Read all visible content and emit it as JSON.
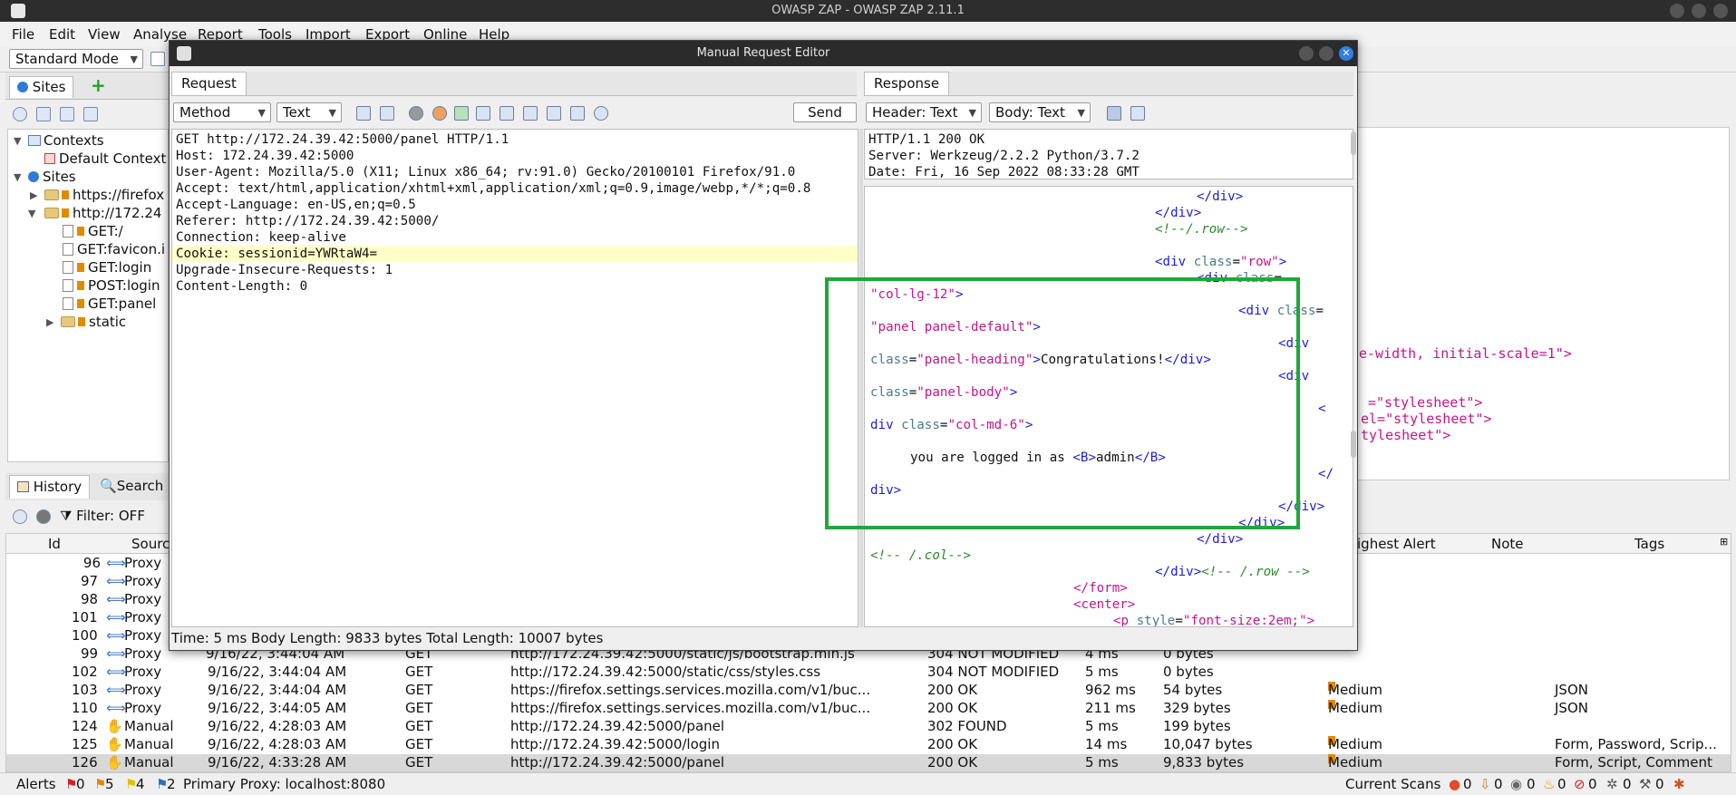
{
  "os": {
    "title": "OWASP ZAP - OWASP ZAP 2.11.1"
  },
  "menu": [
    "File",
    "Edit",
    "View",
    "Analyse",
    "Report",
    "Tools",
    "Import",
    "Export",
    "Online",
    "Help"
  ],
  "toolbar": {
    "mode": "Standard Mode"
  },
  "sites": {
    "tab": "Sites",
    "tree": {
      "contexts": "Contexts",
      "default_context": "Default Context",
      "sites": "Sites",
      "site1": "https://firefox",
      "site2": "http://172.24",
      "children": [
        "GET:/",
        "GET:favicon.i",
        "GET:login",
        "POST:login",
        "GET:panel"
      ],
      "static": "static"
    }
  },
  "bg_right": {
    "line1": "e-width, initial-scale=1\">",
    "line2": "=\"stylesheet\">",
    "line3": "el=\"stylesheet\">",
    "line4": "tylesheet\">"
  },
  "history": {
    "tab": "History",
    "search_tab": "Search",
    "filter": "Filter: OFF",
    "columns": {
      "id": "Id",
      "source": "Source",
      "alert": "ighest Alert",
      "note": "Note",
      "tags": "Tags"
    },
    "rows": [
      {
        "id": "96",
        "src": "Proxy",
        "time": "",
        "method": "",
        "url": "",
        "code": "",
        "rtt": "",
        "size": "",
        "alert": "",
        "tags": ""
      },
      {
        "id": "97",
        "src": "Proxy",
        "time": "",
        "method": "",
        "url": "",
        "code": "",
        "rtt": "",
        "size": "",
        "alert": "",
        "tags": ""
      },
      {
        "id": "98",
        "src": "Proxy",
        "time": "",
        "method": "",
        "url": "",
        "code": "",
        "rtt": "",
        "size": "",
        "alert": "",
        "tags": ""
      },
      {
        "id": "101",
        "src": "Proxy",
        "time": "",
        "method": "",
        "url": "",
        "code": "",
        "rtt": "",
        "size": "",
        "alert": "",
        "tags": ""
      },
      {
        "id": "100",
        "src": "Proxy",
        "time": "",
        "method": "",
        "url": "",
        "code": "",
        "rtt": "",
        "size": "",
        "alert": "",
        "tags": ""
      },
      {
        "id": "99",
        "src": "Proxy",
        "time": "",
        "method": "",
        "url": "",
        "code": "",
        "rtt": "",
        "size": "",
        "alert": "",
        "tags": ""
      },
      {
        "id": "102",
        "src": "Proxy",
        "time": "9/16/22, 3:44:04 AM",
        "method": "GET",
        "url": "http://172.24.39.42:5000/static/css/styles.css",
        "code": "304 NOT MODIFIED",
        "rtt": "5 ms",
        "size": "0 bytes",
        "alert": "",
        "tags": ""
      },
      {
        "id": "103",
        "src": "Proxy",
        "time": "9/16/22, 3:44:04 AM",
        "method": "GET",
        "url": "https://firefox.settings.services.mozilla.com/v1/buc...",
        "code": "200 OK",
        "rtt": "962 ms",
        "size": "54 bytes",
        "alert": "Medium",
        "tags": "JSON"
      },
      {
        "id": "110",
        "src": "Proxy",
        "time": "9/16/22, 3:44:05 AM",
        "method": "GET",
        "url": "https://firefox.settings.services.mozilla.com/v1/buc...",
        "code": "200 OK",
        "rtt": "211 ms",
        "size": "329 bytes",
        "alert": "Medium",
        "tags": "JSON"
      },
      {
        "id": "124",
        "src": "Manual",
        "time": "9/16/22, 4:28:03 AM",
        "method": "GET",
        "url": "http://172.24.39.42:5000/panel",
        "code": "302 FOUND",
        "rtt": "5 ms",
        "size": "199 bytes",
        "alert": "",
        "tags": ""
      },
      {
        "id": "125",
        "src": "Manual",
        "time": "9/16/22, 4:28:03 AM",
        "method": "GET",
        "url": "http://172.24.39.42:5000/login",
        "code": "200 OK",
        "rtt": "14 ms",
        "size": "10,047 bytes",
        "alert": "Medium",
        "tags": "Form, Password, Scrip..."
      },
      {
        "id": "126",
        "src": "Manual",
        "time": "9/16/22, 4:33:28 AM",
        "method": "GET",
        "url": "http://172.24.39.42:5000/panel",
        "code": "200 OK",
        "rtt": "5 ms",
        "size": "9,833 bytes",
        "alert": "Medium",
        "tags": "Form, Script, Comment"
      }
    ],
    "partial_row": {
      "time": "9/16/22, 3:44:04 AM",
      "method": "GET",
      "url": "http://172.24.39.42:5000/static/js/bootstrap.min.js",
      "code": "304 NOT MODIFIED",
      "rtt": "4 ms",
      "size": "0 bytes"
    }
  },
  "status": {
    "alerts": "Alerts",
    "a_red": "0",
    "a_orange": "5",
    "a_yellow": "4",
    "a_blue": "2",
    "proxy": "Primary Proxy: localhost:8080",
    "scans": "Current Scans",
    "counts": [
      "0",
      "0",
      "0",
      "0",
      "0",
      "0",
      "0"
    ]
  },
  "dialog": {
    "title": "Manual Request Editor",
    "request_tab": "Request",
    "response_tab": "Response",
    "method_combo": "Method",
    "text_combo": "Text",
    "send": "Send",
    "header_combo": "Header: Text",
    "body_combo": "Body: Text",
    "request_lines": [
      "GET http://172.24.39.42:5000/panel HTTP/1.1",
      "Host: 172.24.39.42:5000",
      "User-Agent: Mozilla/5.0 (X11; Linux x86_64; rv:91.0) Gecko/20100101 Firefox/91.0",
      "Accept: text/html,application/xhtml+xml,application/xml;q=0.9,image/webp,*/*;q=0.8",
      "Accept-Language: en-US,en;q=0.5",
      "Referer: http://172.24.39.42:5000/",
      "Connection: keep-alive",
      "Cookie: sessionid=YWRtaW4=",
      "Upgrade-Insecure-Requests: 1",
      "Content-Length: 0"
    ],
    "response_header": [
      "HTTP/1.1 200 OK",
      "Server: Werkzeug/2.2.2 Python/3.7.2",
      "Date: Fri, 16 Sep 2022 08:33:28 GMT"
    ],
    "status_line": "Time: 5 ms Body Length: 9833 bytes Total Length: 10007 bytes"
  }
}
